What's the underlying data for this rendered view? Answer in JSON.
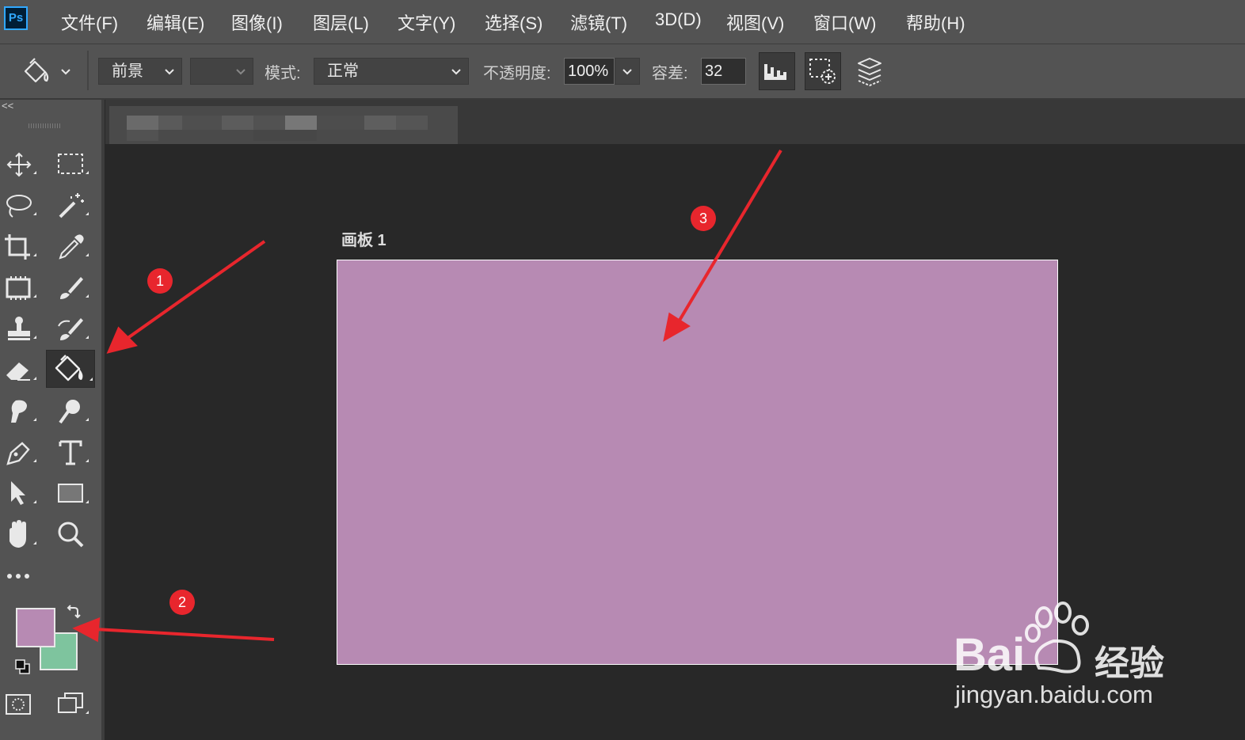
{
  "app": {
    "logo": "Ps"
  },
  "menu": [
    {
      "label": "文件(F)"
    },
    {
      "label": "编辑(E)"
    },
    {
      "label": "图像(I)"
    },
    {
      "label": "图层(L)"
    },
    {
      "label": "文字(Y)"
    },
    {
      "label": "选择(S)"
    },
    {
      "label": "滤镜(T)"
    },
    {
      "label": "3D(D)"
    },
    {
      "label": "视图(V)"
    },
    {
      "label": "窗口(W)"
    },
    {
      "label": "帮助(H)"
    }
  ],
  "options": {
    "tool_icon": "paint-bucket-icon",
    "fill_source": "前景",
    "mode_label": "模式:",
    "mode_value": "正常",
    "opacity_label": "不透明度:",
    "opacity_value": "100%",
    "tolerance_label": "容差:",
    "tolerance_value": "32"
  },
  "panel_collapse": "<<",
  "tools": [
    "move-icon",
    "marquee-icon",
    "lasso-icon",
    "magic-wand-icon",
    "crop-icon",
    "eyedropper-icon",
    "frame-icon",
    "brush-icon",
    "stamp-icon",
    "history-brush-icon",
    "eraser-icon",
    "paint-bucket-icon",
    "smudge-icon",
    "dodge-icon",
    "pen-icon",
    "type-icon",
    "path-select-icon",
    "rectangle-icon",
    "hand-icon",
    "zoom-icon",
    "more-icon"
  ],
  "colors": {
    "foreground": "#b78ab3",
    "background": "#7ec49e",
    "accent_annotation": "#e8262d"
  },
  "canvas": {
    "artboard_label": "画板 1",
    "artboard_fill": "#b78ab3"
  },
  "annotations": [
    {
      "label": "1"
    },
    {
      "label": "2"
    },
    {
      "label": "3"
    }
  ],
  "watermark": {
    "brand": "Bai",
    "brand_suffix": "经验",
    "url": "jingyan.baidu.com"
  }
}
